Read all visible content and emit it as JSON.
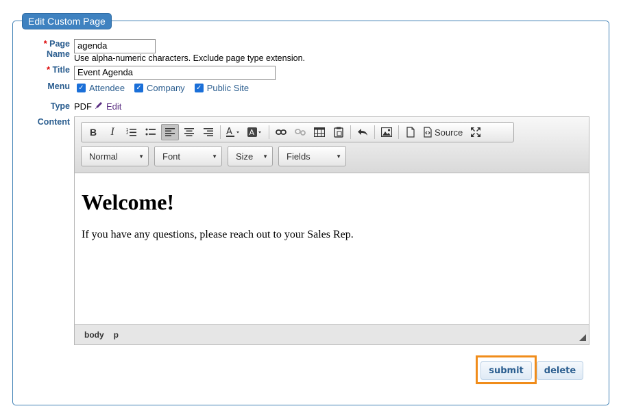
{
  "legend": "Edit Custom Page",
  "form": {
    "page_name_label_line1": "Page",
    "page_name_label_line2": "Name",
    "required_mark": "*",
    "page_name_value": "agenda",
    "page_name_hint": "Use alpha-numeric characters. Exclude page type extension.",
    "title_label": "Title",
    "title_value": "Event Agenda",
    "menu_label": "Menu",
    "menu_options": [
      {
        "label": "Attendee",
        "checked": true
      },
      {
        "label": "Company",
        "checked": true
      },
      {
        "label": "Public Site",
        "checked": true
      }
    ],
    "type_label": "Type",
    "type_value": "PDF",
    "type_edit_label": "Edit",
    "content_label": "Content"
  },
  "editor": {
    "source_label": "Source",
    "combos": {
      "format": "Normal",
      "font": "Font",
      "size": "Size",
      "fields": "Fields"
    },
    "content_heading": "Welcome!",
    "content_paragraph": "If you have any questions, please reach out to your Sales Rep.",
    "path": [
      "body",
      "p"
    ]
  },
  "actions": {
    "submit_label": "submit",
    "delete_label": "delete"
  },
  "colors": {
    "accent": "#3f82c0",
    "label": "#2a5d8f",
    "highlight": "#f08c1a"
  }
}
